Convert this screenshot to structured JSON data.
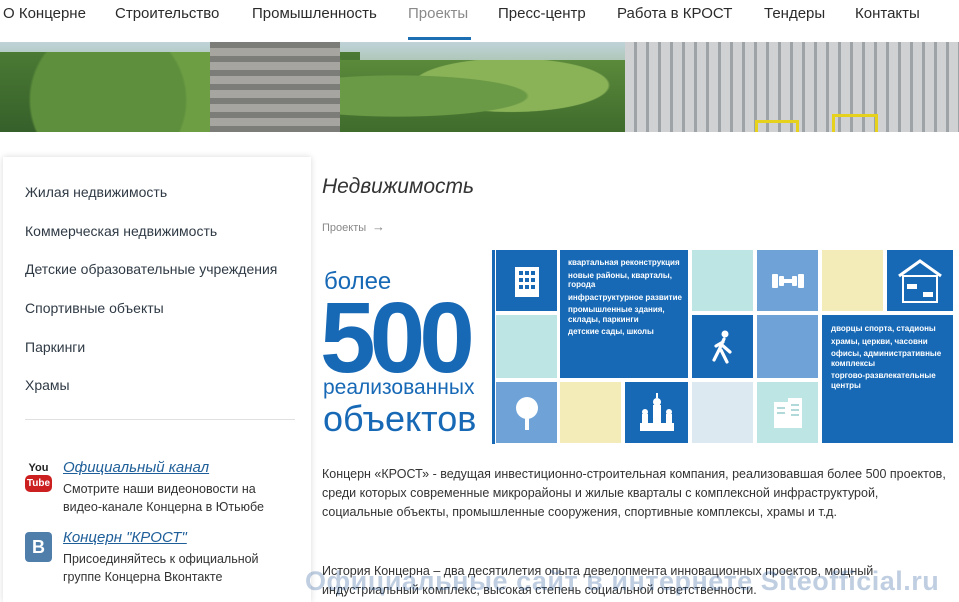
{
  "nav": {
    "items": [
      "О Концерне",
      "Строительство",
      "Промышленность",
      "Проекты",
      "Пресс-центр",
      "Работа в КРОСТ",
      "Тендеры",
      "Контакты"
    ],
    "active": "Проекты",
    "accent": "#1d6fb4"
  },
  "sidebar": {
    "items": [
      "Жилая недвижимость",
      "Коммерческая недвижимость",
      "Детские образовательные учреждения",
      "Спортивные объекты",
      "Паркинги",
      "Храмы"
    ],
    "youtube": {
      "icon_top": "You",
      "icon_bottom": "Tube",
      "link": "Официальный канал",
      "desc": "Смотрите наши видеоновости на видео-канале Концерна в Ютьюбе"
    },
    "vk": {
      "icon": "B",
      "link": "Концерн \"КРОСТ\"",
      "desc": "Присоединяйтесь к официальной группе Концерна Вконтакте"
    }
  },
  "main": {
    "title": "Недвижимость",
    "breadcrumb": "Проекты",
    "breadcrumb_arrow": "→",
    "infographic": {
      "more": "более",
      "number": "500",
      "line1": "реализованных",
      "line2": "объектов",
      "left_list": [
        "квартальная реконструкция",
        "новые районы, кварталы, города",
        "инфраструктурное развитие",
        "промышленные здания, склады, паркинги",
        "детские сады, школы"
      ],
      "right_list": [
        "дворцы спорта, стадионы",
        "храмы, церкви, часовни",
        "офисы, административные комплексы",
        "торгово-развлекательные центры"
      ]
    },
    "para1": "Концерн «КРОСТ» - ведущая инвестиционно-строительная компания, реализовавшая более 500 проектов, среди которых современные микрорайоны и жилые кварталы с комплексной инфраструктурой, социальные объекты, промышленные сооружения, спортивные комплексы, храмы и т.д.",
    "para2": "История Концерна – два десятилетия опыта девелопмента инновационных проектов, мощный индустриальный комплекс, высокая степень социальной ответственности.",
    "watermark": "Официальные сайт в интернете Siteofficial.ru"
  },
  "colors": {
    "brand_blue": "#1769b6",
    "light_blue": "#6fa3d8",
    "mint": "#bde5e3",
    "cream": "#f3ecb8"
  }
}
